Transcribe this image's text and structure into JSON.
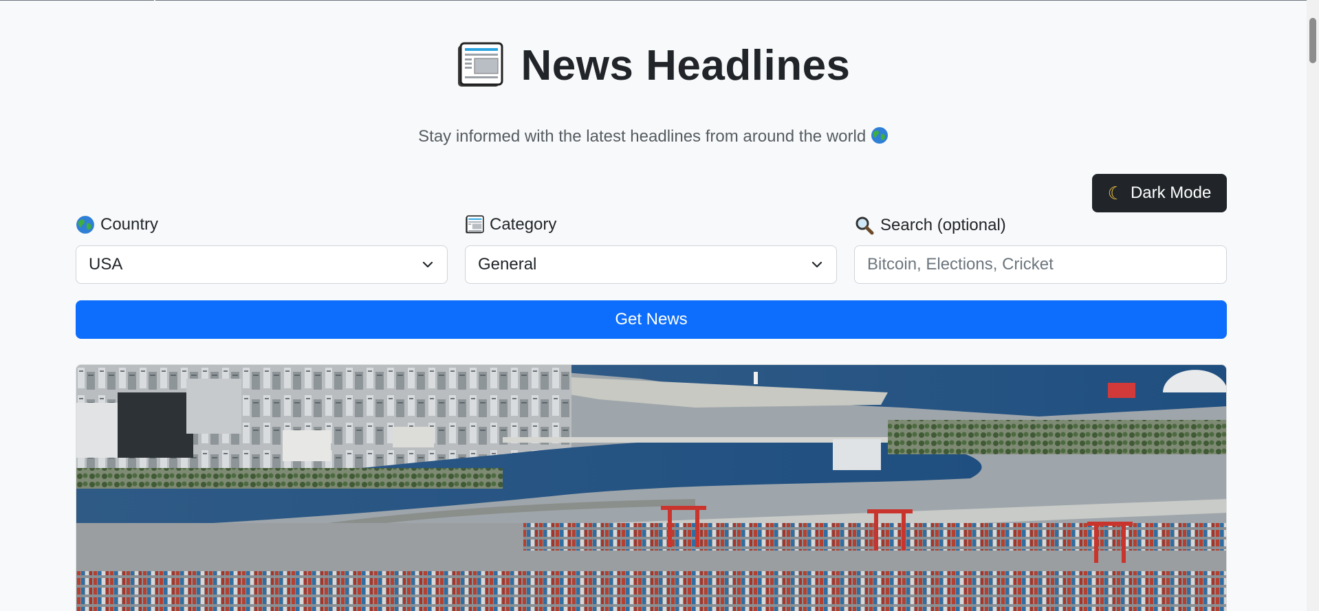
{
  "header": {
    "title": "News Headlines",
    "icon": "newspaper-icon",
    "subtitle": "Stay informed with the latest headlines from around the world"
  },
  "theme_toggle": {
    "label": "Dark Mode",
    "icon": "moon-icon"
  },
  "filters": {
    "country": {
      "label": "Country",
      "icon": "globe-icon",
      "value": "USA"
    },
    "category": {
      "label": "Category",
      "icon": "newspaper-icon",
      "value": "General"
    },
    "search": {
      "label": "Search (optional)",
      "icon": "magnifier-icon",
      "placeholder": "Bitcoin, Elections, Cricket"
    }
  },
  "actions": {
    "get_news_label": "Get News"
  },
  "article": {
    "image": "aerial-port-city-photo"
  },
  "colors": {
    "background": "#f8f9fa",
    "primary": "#0d6efd",
    "dark_button": "#212529",
    "text": "#212529",
    "muted": "#555b61"
  }
}
